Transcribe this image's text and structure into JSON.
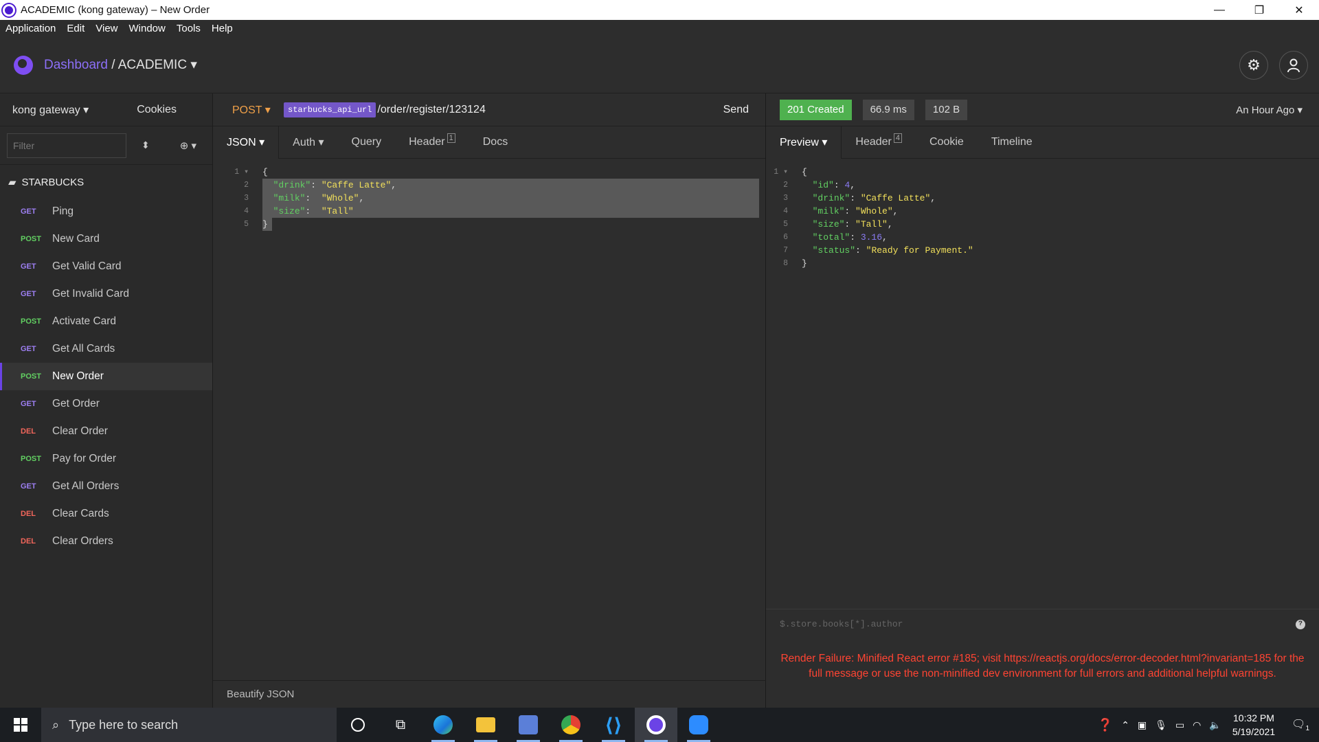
{
  "window": {
    "title": "ACADEMIC (kong gateway) – New Order",
    "minimize": "—",
    "restore": "❐",
    "close": "✕"
  },
  "menu": [
    "Application",
    "Edit",
    "View",
    "Window",
    "Tools",
    "Help"
  ],
  "header": {
    "dashboard": "Dashboard",
    "separator": "/",
    "project": "ACADEMIC ▾"
  },
  "sidebar": {
    "workspace": "kong gateway ▾",
    "cookies": "Cookies",
    "filter_placeholder": "Filter",
    "folder": "STARBUCKS",
    "requests": [
      {
        "method": "GET",
        "name": "Ping"
      },
      {
        "method": "POST",
        "name": "New Card"
      },
      {
        "method": "GET",
        "name": "Get Valid Card"
      },
      {
        "method": "GET",
        "name": "Get Invalid Card"
      },
      {
        "method": "POST",
        "name": "Activate Card"
      },
      {
        "method": "GET",
        "name": "Get All Cards"
      },
      {
        "method": "POST",
        "name": "New Order"
      },
      {
        "method": "GET",
        "name": "Get Order"
      },
      {
        "method": "DEL",
        "name": "Clear Order"
      },
      {
        "method": "POST",
        "name": "Pay for Order"
      },
      {
        "method": "GET",
        "name": "Get All Orders"
      },
      {
        "method": "DEL",
        "name": "Clear Cards"
      },
      {
        "method": "DEL",
        "name": "Clear Orders"
      }
    ]
  },
  "request": {
    "method": "POST ▾",
    "url_variable": "starbucks_api_url",
    "url_path": "/order/register/123124",
    "send": "Send",
    "tabs": {
      "json": "JSON ▾",
      "auth": "Auth ▾",
      "query": "Query",
      "header": "Header",
      "header_count": "1",
      "docs": "Docs"
    },
    "beautify": "Beautify JSON"
  },
  "response": {
    "status": "201 Created",
    "time": "66.9 ms",
    "size": "102 B",
    "time_ago": "An Hour Ago ▾",
    "tabs": {
      "preview": "Preview ▾",
      "header": "Header",
      "header_count": "4",
      "cookie": "Cookie",
      "timeline": "Timeline"
    },
    "jsonpath_placeholder": "$.store.books[*].author",
    "help": "?",
    "error": "Render Failure: Minified React error #185; visit https://reactjs.org/docs/error-decoder.html?invariant=185 for the full message or use the non-minified dev environment for full errors and additional helpful warnings."
  },
  "taskbar": {
    "search_placeholder": "Type here to search",
    "time": "10:32 PM",
    "date": "5/19/2021",
    "notifications": "1"
  }
}
